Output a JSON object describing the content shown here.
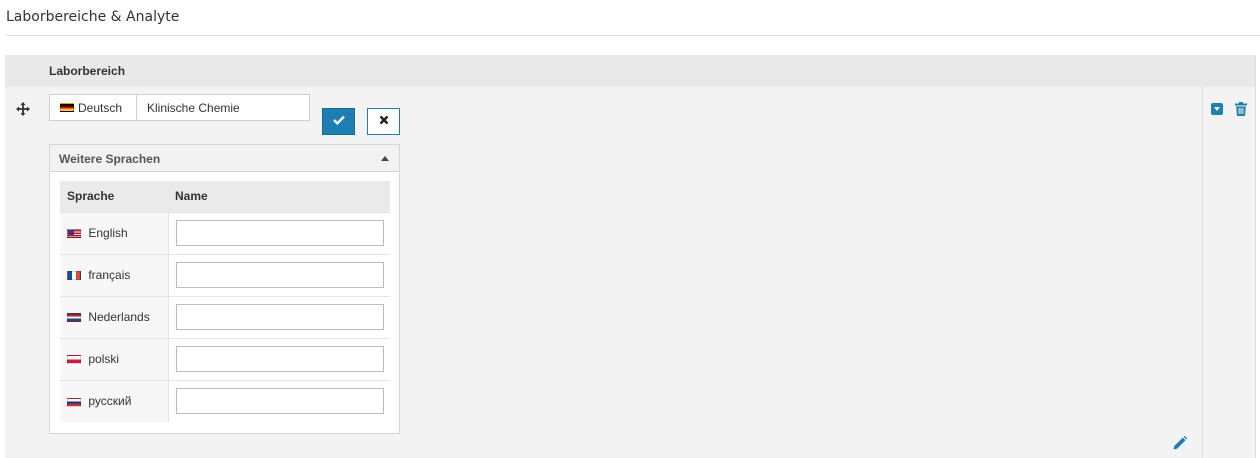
{
  "page": {
    "title": "Laborbereiche & Analyte"
  },
  "panel": {
    "header_label": "Laborbereich",
    "primary_language": {
      "flag": "de",
      "label": "Deutsch",
      "value": "Klinische Chemie"
    }
  },
  "other_languages": {
    "title": "Weitere Sprachen",
    "columns": [
      "Sprache",
      "Name"
    ],
    "rows": [
      {
        "flag": "us",
        "language": "English",
        "name": ""
      },
      {
        "flag": "fr",
        "language": "français",
        "name": ""
      },
      {
        "flag": "nl",
        "language": "Nederlands",
        "name": ""
      },
      {
        "flag": "pl",
        "language": "polski",
        "name": ""
      },
      {
        "flag": "ru",
        "language": "русский",
        "name": ""
      }
    ]
  },
  "icons": {
    "move": "move-arrows-icon",
    "confirm": "check-icon",
    "cancel": "close-icon",
    "collapse": "caret-up-icon",
    "dropdown": "caret-square-down-icon",
    "delete": "trash-icon",
    "edit": "pencil-icon"
  },
  "colors": {
    "accent": "#1b7fb3"
  }
}
